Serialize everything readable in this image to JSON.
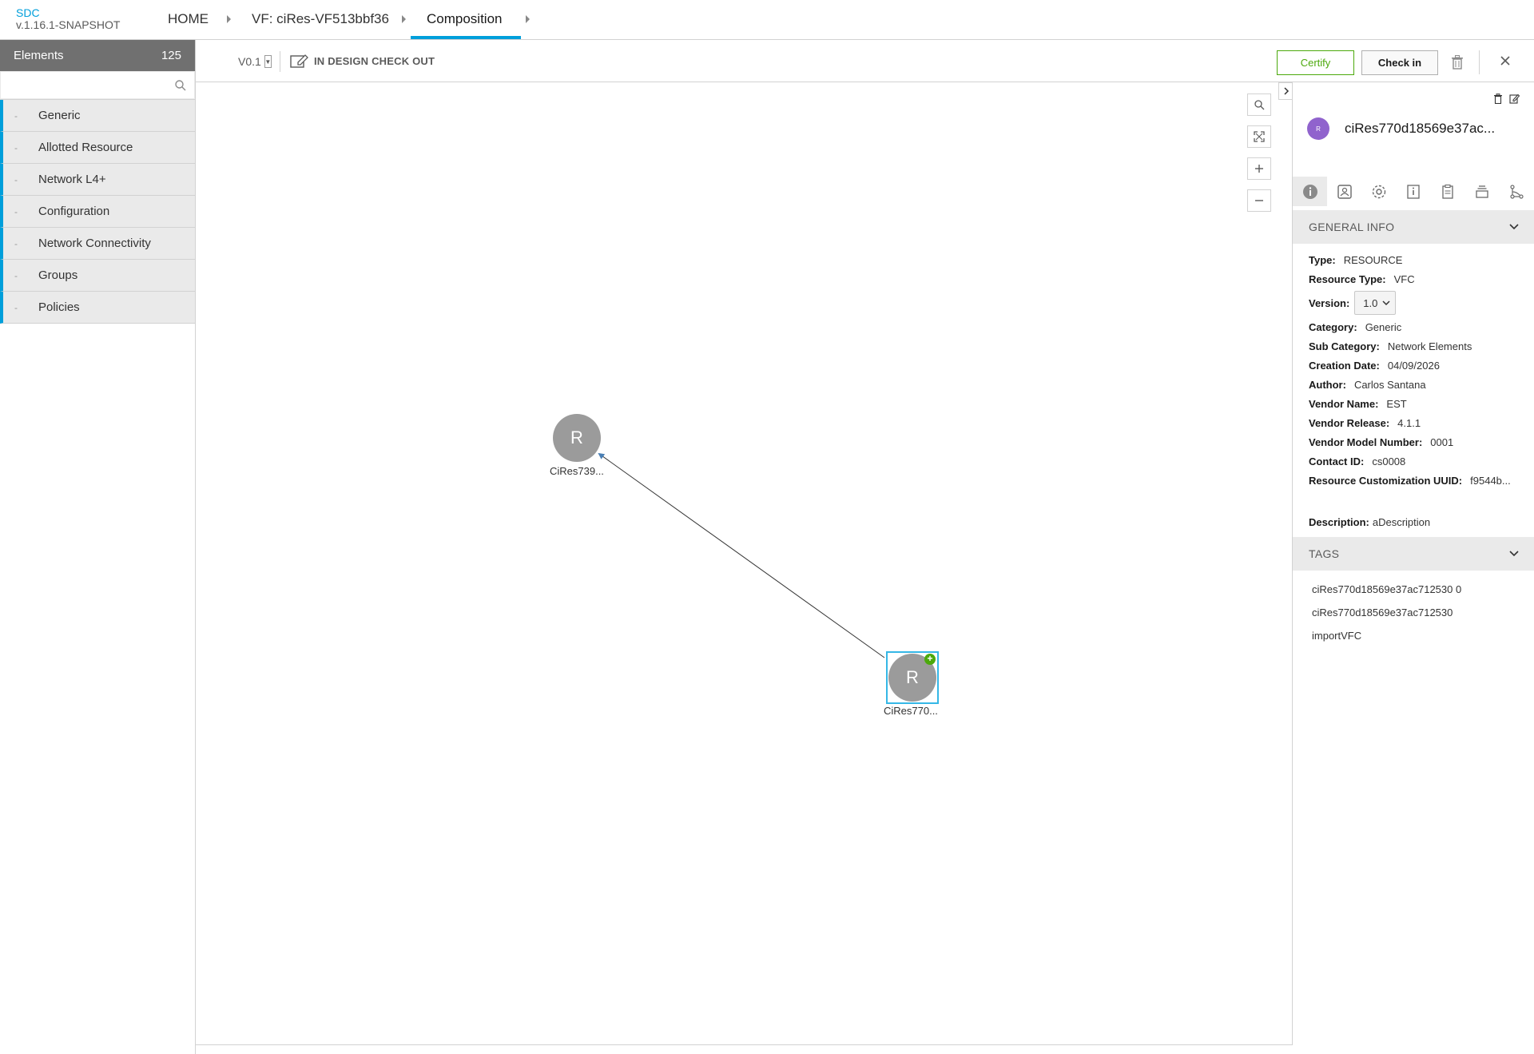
{
  "app": {
    "name": "SDC",
    "version": "v.1.16.1-SNAPSHOT"
  },
  "breadcrumb": {
    "home": "HOME",
    "vf": "VF: ciRes-VF513bbf36",
    "current": "Composition"
  },
  "palette": {
    "title": "Elements",
    "count": "125",
    "search_placeholder": "",
    "categories": [
      "Generic",
      "Allotted Resource",
      "Network L4+",
      "Configuration",
      "Network Connectivity",
      "Groups",
      "Policies"
    ]
  },
  "toolbar": {
    "version": "V0.1",
    "state": "IN DESIGN CHECK OUT",
    "certify_label": "Certify",
    "checkin_label": "Check in"
  },
  "canvas": {
    "nodes": [
      {
        "letter": "R",
        "label": "CiRes739..."
      },
      {
        "letter": "R",
        "label": "CiRes770..."
      }
    ]
  },
  "panel": {
    "avatar_letter": "R",
    "title": "ciRes770d18569e37ac...",
    "general_info_title": "GENERAL INFO",
    "fields": {
      "type_label": "Type:",
      "type": "RESOURCE",
      "resource_type_label": "Resource Type:",
      "resource_type": "VFC",
      "version_label": "Version:",
      "version": "1.0",
      "category_label": "Category:",
      "category": "Generic",
      "sub_category_label": "Sub Category:",
      "sub_category": "Network Elements",
      "creation_date_label": "Creation Date:",
      "creation_date": "04/09/2026",
      "author_label": "Author:",
      "author": "Carlos Santana",
      "vendor_name_label": "Vendor Name:",
      "vendor_name": "EST",
      "vendor_release_label": "Vendor Release:",
      "vendor_release": "4.1.1",
      "vendor_model_label": "Vendor Model Number:",
      "vendor_model": "0001",
      "contact_id_label": "Contact ID:",
      "contact_id": "cs0008",
      "customization_uuid_label": "Resource Customization UUID:",
      "customization_uuid": "f9544b...",
      "description_label": "Description:",
      "description": "aDescription"
    },
    "tags_title": "TAGS",
    "tags": [
      "ciRes770d18569e37ac712530 0",
      "ciRes770d18569e37ac712530",
      "importVFC"
    ]
  },
  "colors": {
    "accent": "#009fdb",
    "certify": "#4ca90c",
    "node": "#9b9b9b",
    "avatar": "#9063cd"
  }
}
